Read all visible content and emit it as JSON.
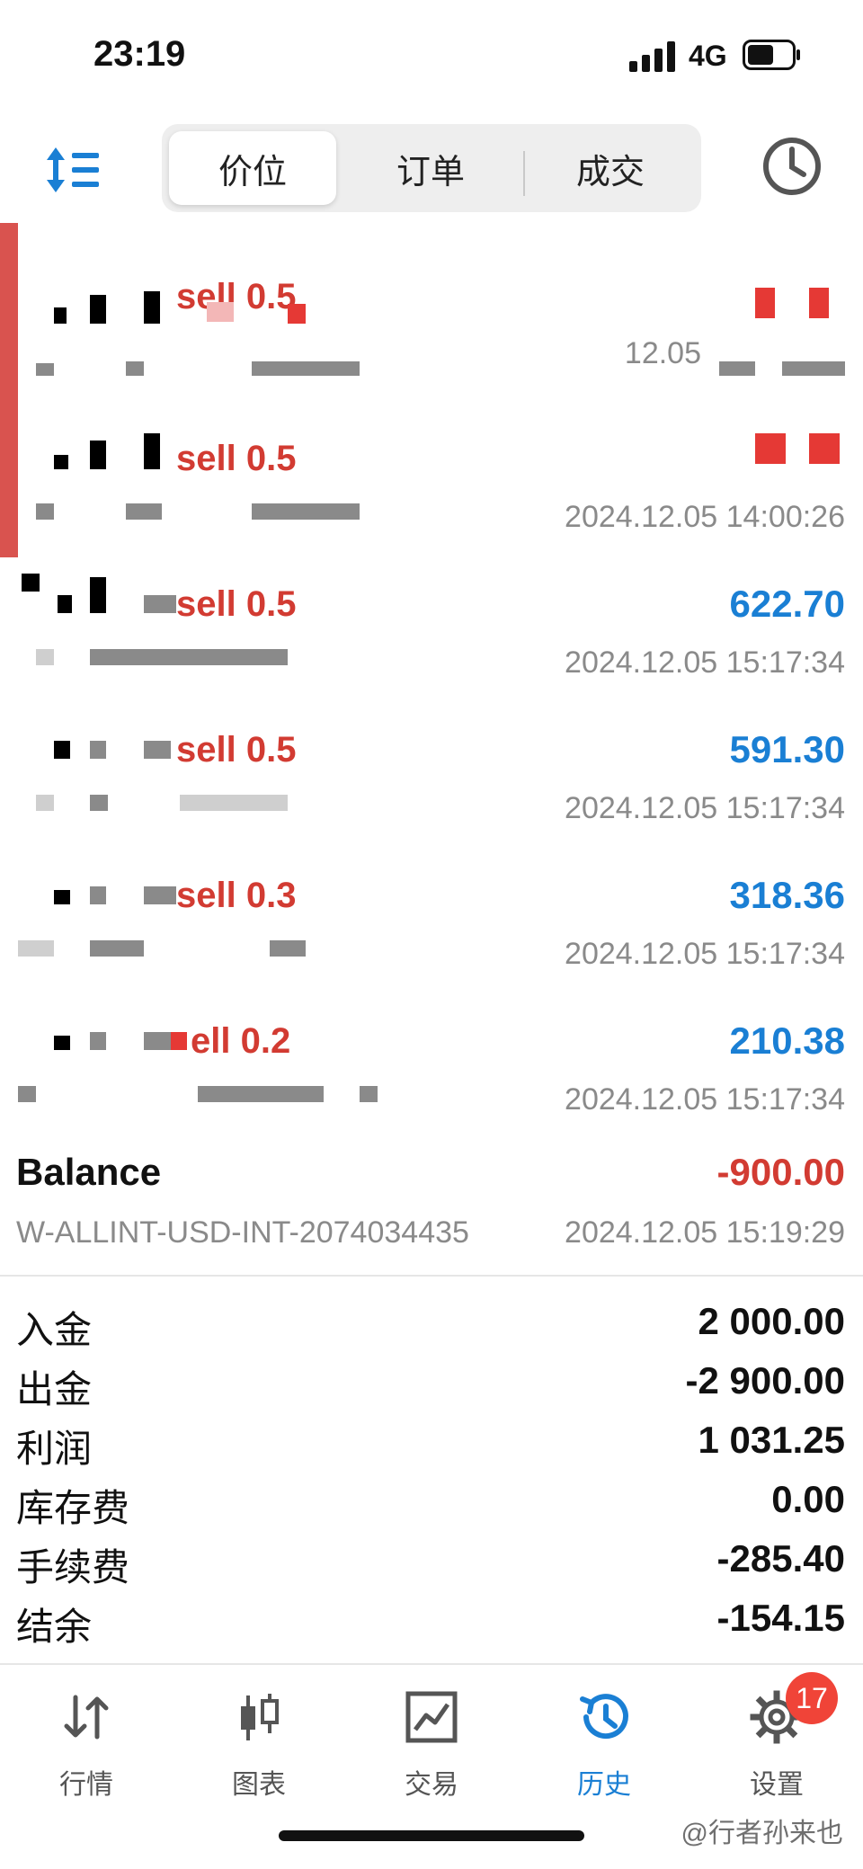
{
  "status_bar": {
    "time": "23:19",
    "network": "4G"
  },
  "tabs_top": {
    "items": [
      "价位",
      "订单",
      "成交"
    ],
    "active_index": 0
  },
  "deals": [
    {
      "type": "sell 0.5",
      "profit": "",
      "time": "12.05"
    },
    {
      "type": "sell 0.5",
      "profit": "",
      "time": "2024.12.05 14:00:26"
    },
    {
      "type": "sell 0.5",
      "profit": "622.70",
      "time": "2024.12.05 15:17:34"
    },
    {
      "type": "sell 0.5",
      "profit": "591.30",
      "time": "2024.12.05 15:17:34"
    },
    {
      "type": "sell 0.3",
      "profit": "318.36",
      "time": "2024.12.05 15:17:34"
    },
    {
      "type": "ell 0.2",
      "profit": "210.38",
      "time": "2024.12.05 15:17:34"
    }
  ],
  "balance": {
    "title": "Balance",
    "amount": "-900.00",
    "account": "W-ALLINT-USD-INT-2074034435",
    "time": "2024.12.05 15:19:29"
  },
  "summary": [
    {
      "label": "入金",
      "value": "2 000.00"
    },
    {
      "label": "出金",
      "value": "-2 900.00"
    },
    {
      "label": "利润",
      "value": "1 031.25"
    },
    {
      "label": "库存费",
      "value": "0.00"
    },
    {
      "label": "手续费",
      "value": "-285.40"
    },
    {
      "label": "结余",
      "value": "-154.15"
    }
  ],
  "tabbar": {
    "items": [
      {
        "label": "行情",
        "icon": "quotes-arrows-icon"
      },
      {
        "label": "图表",
        "icon": "candlestick-icon"
      },
      {
        "label": "交易",
        "icon": "trade-chart-icon"
      },
      {
        "label": "历史",
        "icon": "history-icon"
      },
      {
        "label": "设置",
        "icon": "gear-icon"
      }
    ],
    "active_index": 3,
    "settings_badge": "17"
  },
  "watermark": "@行者孙来也",
  "colors": {
    "accent": "#1a7fd4",
    "sell": "#d23b32",
    "negative": "#d23b32",
    "badge": "#f04438"
  }
}
